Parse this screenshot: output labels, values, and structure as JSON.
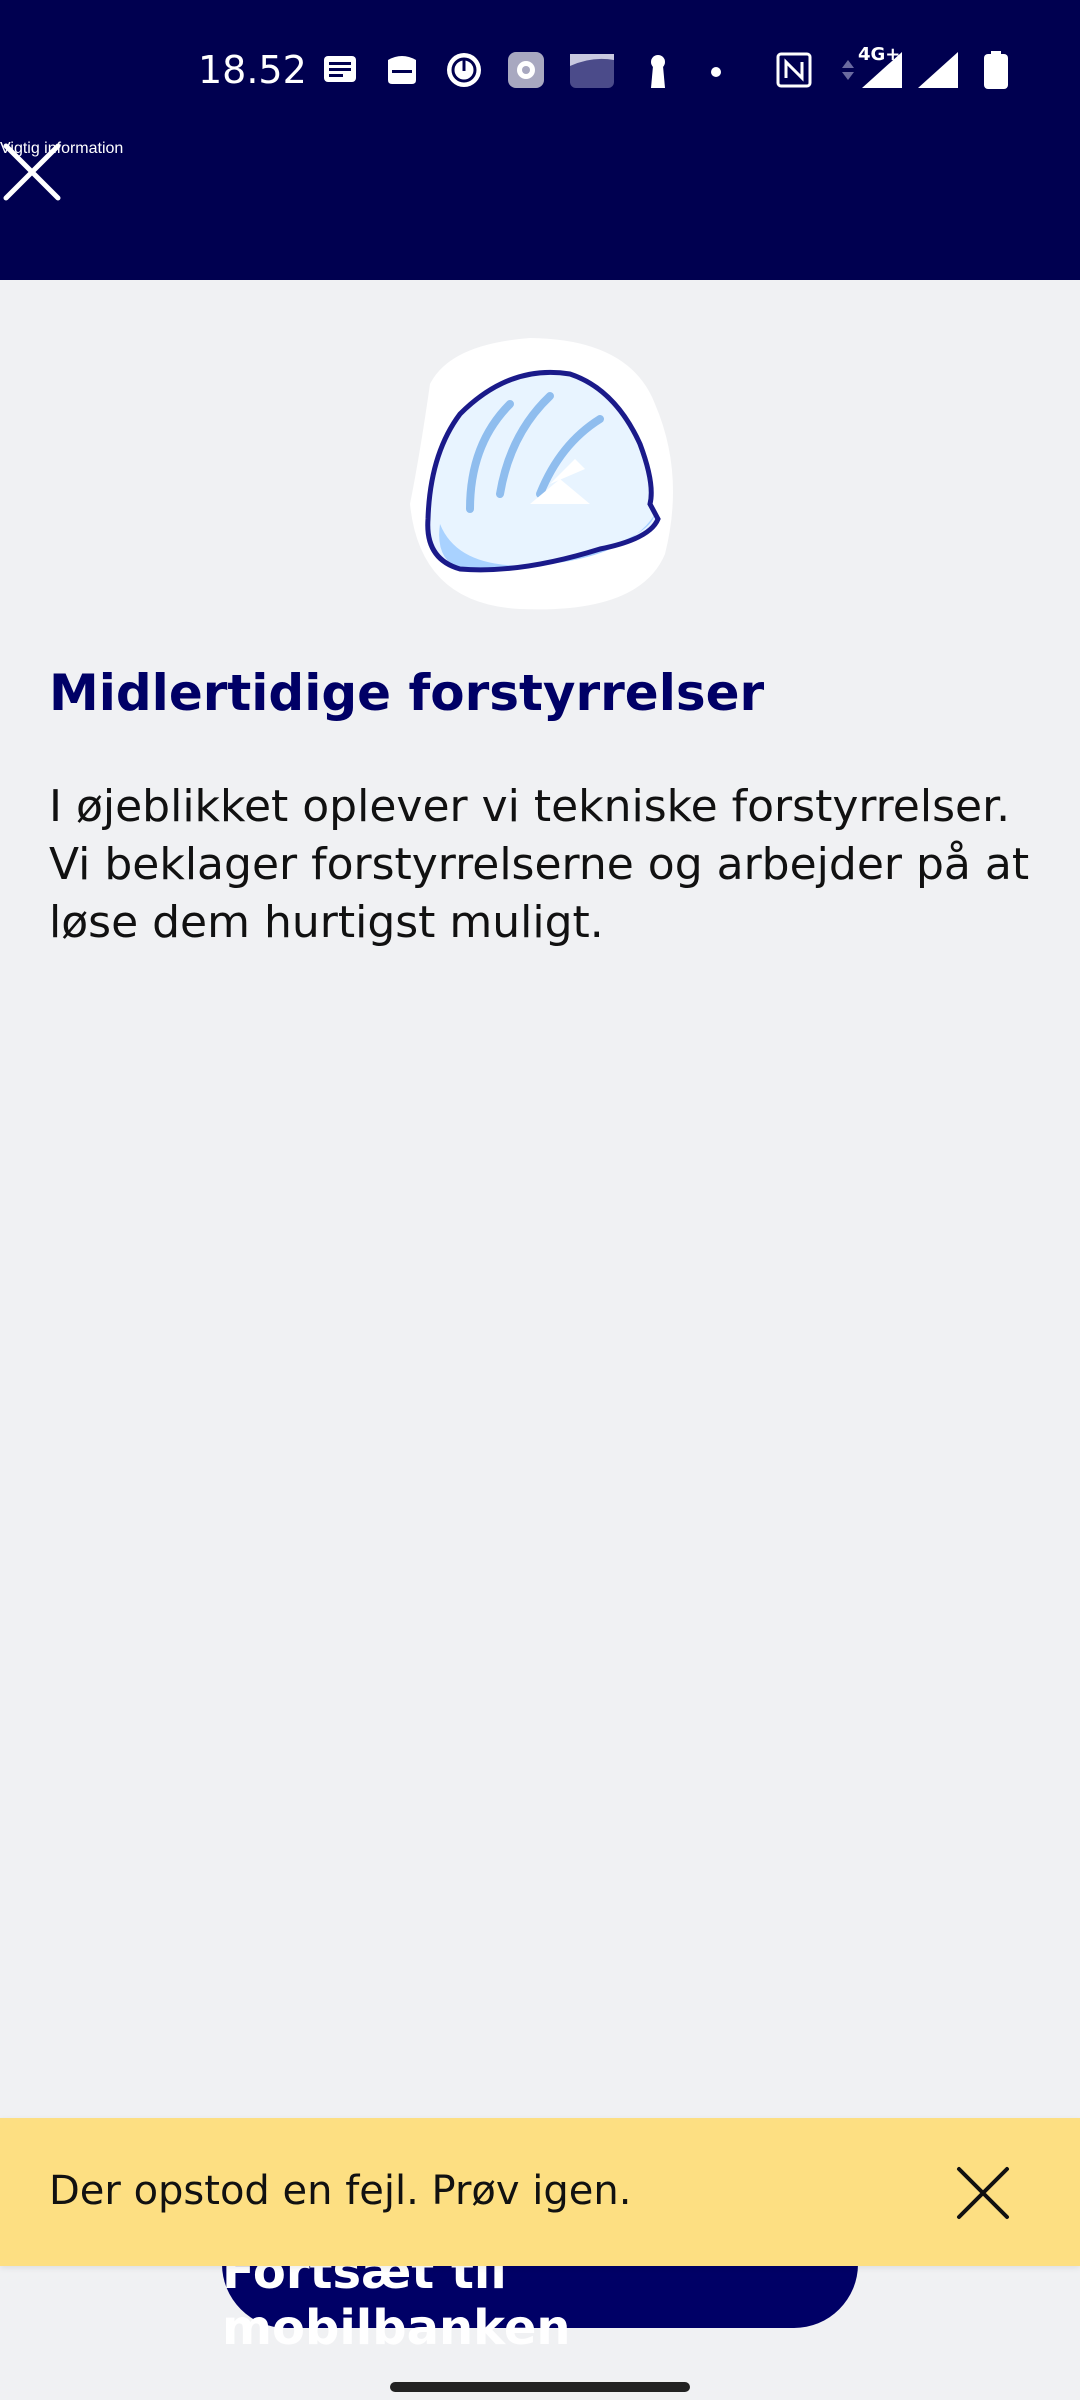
{
  "status_bar": {
    "time": "18.52",
    "network_label": "4G+",
    "icons": [
      "messages-icon",
      "inbox-icon",
      "vpn-icon",
      "settings-icon",
      "wallet-icon",
      "keyhole-icon",
      "dot-icon",
      "nfc-icon",
      "data-arrows-icon",
      "signal-icon",
      "signal-icon",
      "battery-icon"
    ]
  },
  "app_bar": {
    "title": "Vigtig information"
  },
  "content": {
    "heading": "Midlertidige forstyrrelser",
    "body": "I øjeblikket oplever vi tekniske forstyrrelser. Vi beklager forstyrrelserne og arbejder på at løse dem hurtigst muligt."
  },
  "primary_button": {
    "label": "Fortsæt til mobilbanken"
  },
  "toast": {
    "message": "Der opstod en fejl. Prøv igen."
  },
  "colors": {
    "navy": "#000050",
    "button": "#000066",
    "background": "#f0f1f3",
    "toast": "#fddf82"
  }
}
